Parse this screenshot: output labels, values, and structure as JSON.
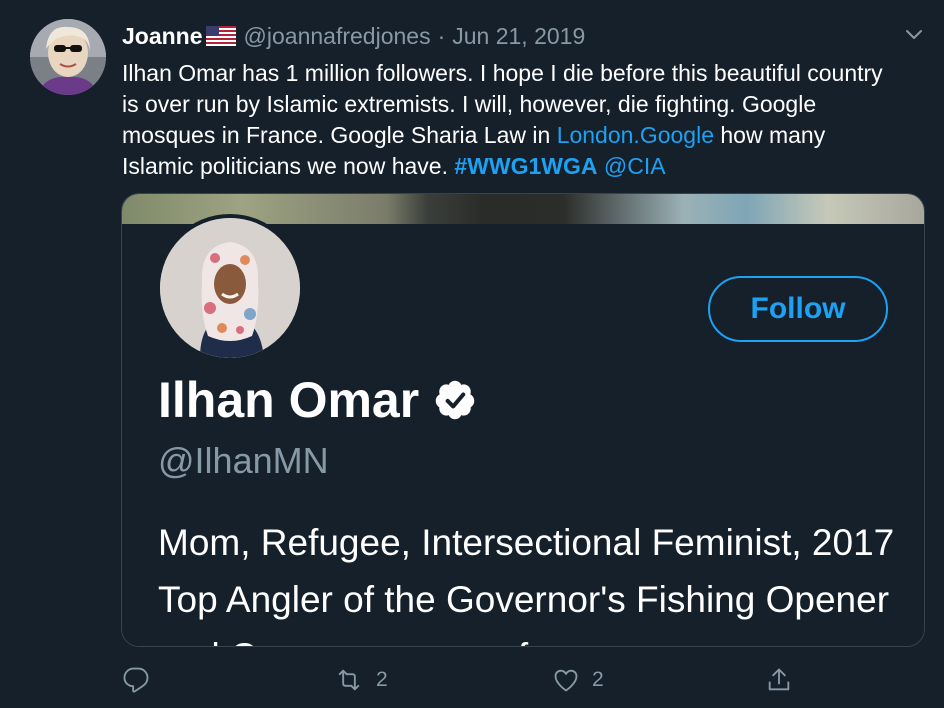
{
  "tweet": {
    "display_name": "Joanne",
    "flag_icon": "us-flag-icon",
    "handle": "@joannafredjones",
    "separator": "·",
    "date": "Jun 21, 2019",
    "text_part1": "Ilhan Omar has 1 million followers. I hope I die before this beautiful country is over run by Islamic extremists. I will, however, die fighting. Google mosques in France. Google Sharia Law in ",
    "link": "London.Google",
    "text_part2": " how many Islamic politicians we now have. ",
    "hashtag": "#WWG1WGA",
    "mention": "@CIA"
  },
  "card": {
    "follow_label": "Follow",
    "name": "Ilhan Omar",
    "handle": "@IlhanMN",
    "bio": "Mom, Refugee, Intersectional Feminist, 2017 Top Angler of the Governor's Fishing Opener and Congresswoman for"
  },
  "actions": {
    "reply_count": "",
    "retweet_count": "2",
    "like_count": "2"
  },
  "colors": {
    "background": "#15202b",
    "accent": "#1da1f2",
    "muted": "#8899a6",
    "border": "#38444d"
  }
}
